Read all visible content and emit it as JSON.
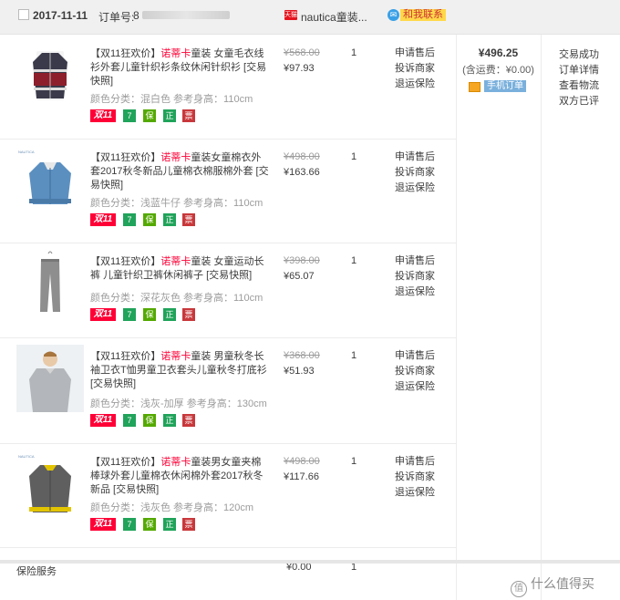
{
  "order": {
    "date": "2017-11-11",
    "order_no_label": "订单号:",
    "order_no_visible": "8",
    "shop_icon_text": "天猫",
    "shop_name": "nautica童装...",
    "contact_label": "和我联系"
  },
  "items": [
    {
      "title_prefix": "【双11狂欢价】",
      "brand": "诺蒂卡",
      "title_rest": "童装 女童毛衣线衫外套儿童针织衫条纹休闲针织衫 [交易快照]",
      "attr": "颜色分类：混白色   参考身高：110cm",
      "price_old": "¥568.00",
      "price_new": "¥97.93",
      "qty": "1",
      "actions": [
        "申请售后",
        "投诉商家",
        "退运保险"
      ]
    },
    {
      "title_prefix": "【双11狂欢价】",
      "brand": "诺蒂卡",
      "title_rest": "童装女童棉衣外套2017秋冬新品儿童棉衣棉服棉外套 [交易快照]",
      "attr": "颜色分类：浅蓝牛仔   参考身高：110cm",
      "price_old": "¥498.00",
      "price_new": "¥163.66",
      "qty": "1",
      "actions": [
        "申请售后",
        "投诉商家",
        "退运保险"
      ]
    },
    {
      "title_prefix": "【双11狂欢价】",
      "brand": "诺蒂卡",
      "title_rest": "童装 女童运动长裤 儿童针织卫裤休闲裤子 [交易快照]",
      "attr": "颜色分类：深花灰色   参考身高：110cm",
      "price_old": "¥398.00",
      "price_new": "¥65.07",
      "qty": "1",
      "actions": [
        "申请售后",
        "投诉商家",
        "退运保险"
      ]
    },
    {
      "title_prefix": "【双11狂欢价】",
      "brand": "诺蒂卡",
      "title_rest": "童装 男童秋冬长袖卫衣T恤男童卫衣套头儿童秋冬打底衫 [交易快照]",
      "attr": "颜色分类：浅灰-加厚   参考身高：130cm",
      "price_old": "¥368.00",
      "price_new": "¥51.93",
      "qty": "1",
      "actions": [
        "申请售后",
        "投诉商家",
        "退运保险"
      ]
    },
    {
      "title_prefix": "【双11狂欢价】",
      "brand": "诺蒂卡",
      "title_rest": "童装男女童夹棉棒球外套儿童棉衣休闲棉外套2017秋冬新品 [交易快照]",
      "attr": "颜色分类：浅灰色   参考身高：120cm",
      "price_old": "¥498.00",
      "price_new": "¥117.66",
      "qty": "1",
      "actions": [
        "申请售后",
        "投诉商家",
        "退运保险"
      ]
    }
  ],
  "badges": {
    "b11": "双11",
    "b7": "7",
    "bs": "保",
    "bz": "正",
    "bf": "票"
  },
  "total": {
    "amount": "¥496.25",
    "shipping": "(含运费：¥0.00)",
    "mobile_label": "手机订单"
  },
  "status": [
    "交易成功",
    "订单详情",
    "查看物流",
    "双方已评"
  ],
  "insurance": {
    "label": "保险服务",
    "price": "¥0.00",
    "qty": "1"
  },
  "watermark": "什么值得买",
  "colors": {
    "accent": "#ff0036",
    "header_bg": "#f0f0f0"
  }
}
